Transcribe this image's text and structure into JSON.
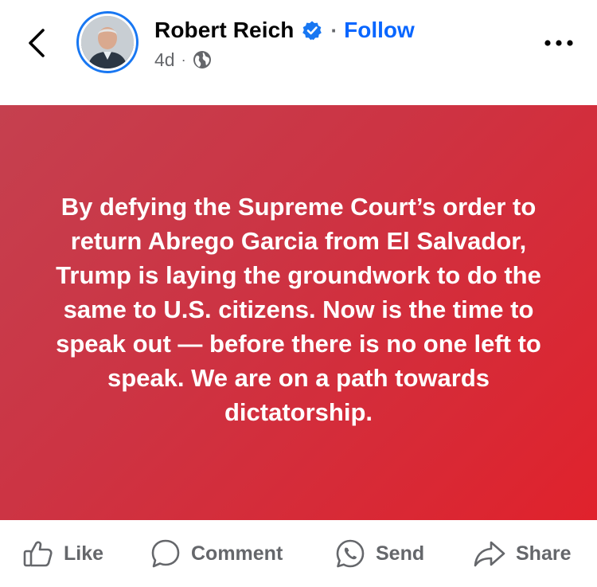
{
  "header": {
    "author_name": "Robert Reich",
    "separator": "·",
    "follow_label": "Follow",
    "time": "4d",
    "meta_separator": "·",
    "privacy_icon": "globe-icon",
    "verified_icon": "verified-badge-icon",
    "colors": {
      "follow": "#0866ff",
      "verified": "#1877f2",
      "secondary_text": "#65676b"
    }
  },
  "post": {
    "text": "By defying the Supreme Court’s order to return Abrego Garcia from El Salvador, Trump is laying the groundwork to do the same to U.S. citizens. Now is the time to speak out — before there is no one left to speak. We are on a path towards dictatorship.",
    "background_colors": [
      "#c5404f",
      "#e0222c"
    ]
  },
  "actions": {
    "like_label": "Like",
    "comment_label": "Comment",
    "send_label": "Send",
    "share_label": "Share"
  }
}
